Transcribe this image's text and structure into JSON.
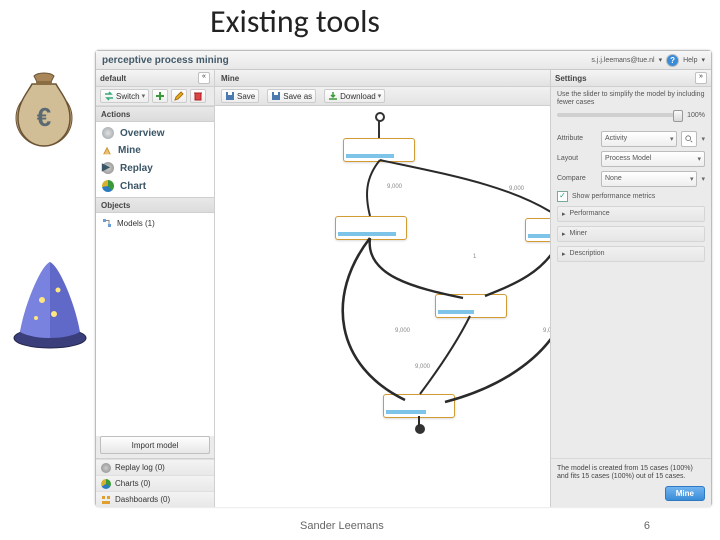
{
  "slide": {
    "title": "Existing tools",
    "author": "Sander Leemans",
    "page": "6"
  },
  "header": {
    "app_name": "perceptive process mining",
    "user": "s.j.j.leemans@tue.nl",
    "help": "Help"
  },
  "leftpanel": {
    "tab": "default",
    "switch": "Switch",
    "section_actions": "Actions",
    "actions": {
      "overview": "Overview",
      "mine": "Mine",
      "replay": "Replay",
      "chart": "Chart"
    },
    "section_objects": "Objects",
    "objects": {
      "models": "Models (1)"
    },
    "import_btn": "Import model",
    "bottom": {
      "replaylog": "Replay log (0)",
      "charts": "Charts (0)",
      "dashboards": "Dashboards (0)"
    }
  },
  "center": {
    "tab": "Mine",
    "toolbar": {
      "save": "Save",
      "saveas": "Save as",
      "download": "Download"
    }
  },
  "rightpanel": {
    "tab": "Settings",
    "hint": "Use the slider to simplify the model by including fewer cases",
    "slider_label": "100%",
    "labels": {
      "attribute": "Attribute",
      "layout": "Layout",
      "compare": "Compare"
    },
    "values": {
      "attribute": "Activity",
      "layout": "Process Model",
      "compare": "None"
    },
    "checkbox": "Show performance metrics",
    "collapsers": {
      "performance": "Performance",
      "miner": "Miner",
      "description": "Description"
    },
    "summary": "The model is created from 15 cases (100%) and fits 15 cases (100%) out of 15 cases.",
    "mine_btn": "Mine"
  }
}
